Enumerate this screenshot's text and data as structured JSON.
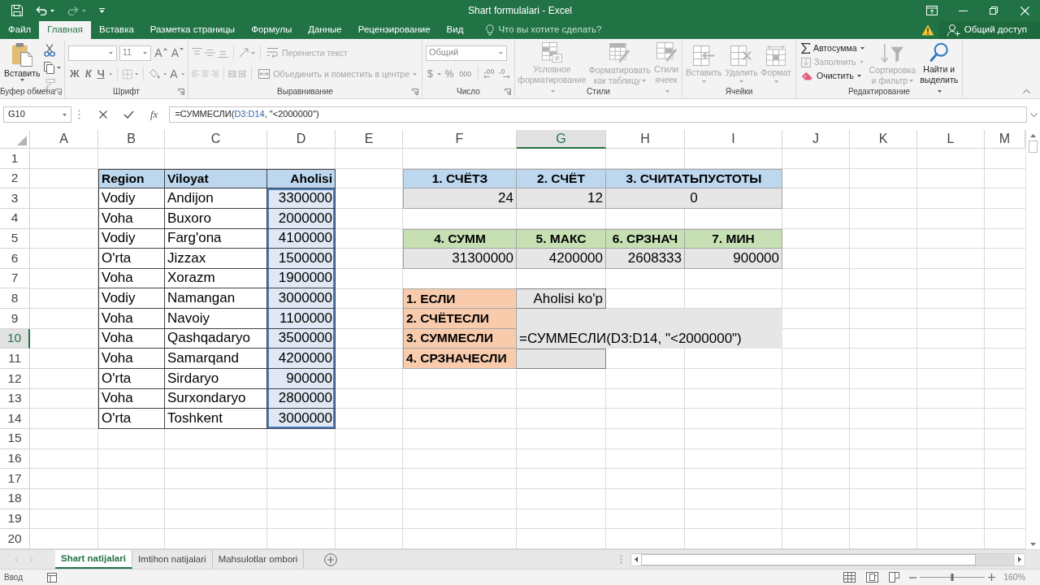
{
  "window": {
    "title": "Shart formulalari - Excel"
  },
  "quick_access": [
    {
      "kind": "save",
      "disabled": false
    },
    {
      "kind": "undo",
      "disabled": false
    },
    {
      "kind": "redo",
      "disabled": true
    },
    {
      "kind": "customize",
      "disabled": false
    }
  ],
  "ribbon_tabs": [
    {
      "label": "Файл",
      "selected": false
    },
    {
      "label": "Главная",
      "selected": true
    },
    {
      "label": "Вставка",
      "selected": false
    },
    {
      "label": "Разметка страницы",
      "selected": false
    },
    {
      "label": "Формулы",
      "selected": false
    },
    {
      "label": "Данные",
      "selected": false
    },
    {
      "label": "Рецензирование",
      "selected": false
    },
    {
      "label": "Вид",
      "selected": false
    }
  ],
  "tell_me": {
    "placeholder": "Что вы хотите сделать?"
  },
  "share_button": {
    "label": "Общий доступ"
  },
  "ribbon": {
    "groups": [
      {
        "kind": "clipboard",
        "label": "Буфер обмена",
        "paste": {
          "label": "Вставить",
          "disabled": false
        },
        "tools": [
          {
            "kind": "cut",
            "disabled": false
          },
          {
            "kind": "copy",
            "disabled": false
          },
          {
            "kind": "format_painter",
            "disabled": true
          }
        ]
      },
      {
        "kind": "font",
        "label": "Шрифт",
        "font_size": "11",
        "size_buttons": [
          {
            "kind": "grow",
            "label": "A"
          },
          {
            "kind": "shrink",
            "label": "A"
          }
        ],
        "style_buttons": [
          {
            "kind": "bold",
            "label": "Ж"
          },
          {
            "kind": "italic",
            "label": "К"
          },
          {
            "kind": "underline",
            "label": "Ч"
          }
        ],
        "color_button": {
          "label": "A"
        }
      },
      {
        "kind": "alignment",
        "label": "Выравнивание",
        "wrap": {
          "label": "Перенести текст",
          "disabled": true
        },
        "merge": {
          "label": "Объединить и поместить в центре",
          "disabled": true
        }
      },
      {
        "kind": "number",
        "label": "Число",
        "format": "Общий",
        "buttons": [
          {
            "kind": "currency",
            "label": "$"
          },
          {
            "kind": "percent",
            "label": "%"
          },
          {
            "kind": "thousands",
            "label": "000"
          }
        ]
      },
      {
        "kind": "styles",
        "label": "Стили",
        "buttons": [
          {
            "kind": "conditional",
            "label": "Условное\nформатирование",
            "disabled": true
          },
          {
            "kind": "table",
            "label": "Форматировать\nкак таблицу",
            "disabled": true
          },
          {
            "kind": "cell_styles",
            "label": "Стили\nячеек",
            "disabled": true
          }
        ]
      },
      {
        "kind": "cells",
        "label": "Ячейки",
        "buttons": [
          {
            "kind": "insert",
            "label": "Вставить",
            "disabled": true
          },
          {
            "kind": "delete",
            "label": "Удалить",
            "disabled": true
          },
          {
            "kind": "format",
            "label": "Формат",
            "disabled": true
          }
        ]
      },
      {
        "kind": "editing",
        "label": "Редактирование",
        "small": [
          {
            "kind": "autosum",
            "label": "Автосумма",
            "disabled": false
          },
          {
            "kind": "fill",
            "label": "Заполнить",
            "disabled": true
          },
          {
            "kind": "clear",
            "label": "Очистить",
            "disabled": false
          }
        ],
        "large": [
          {
            "kind": "sort",
            "label": "Сортировка\nи фильтр",
            "disabled": true
          },
          {
            "kind": "find",
            "label": "Найти и\nвыделить",
            "disabled": false
          }
        ]
      }
    ]
  },
  "formula_bar": {
    "name_box": "G10",
    "function_button": "fx",
    "formula": [
      {
        "text": "=СУММЕСЛИ(",
        "kind": "plain"
      },
      {
        "text": "D3:D14",
        "kind": "reference"
      },
      {
        "text": ", \"<2000000\")",
        "kind": "plain"
      }
    ]
  },
  "sheet": {
    "columns": [
      {
        "label": "A",
        "selected": false
      },
      {
        "label": "B",
        "selected": false
      },
      {
        "label": "C",
        "selected": false
      },
      {
        "label": "D",
        "selected": false
      },
      {
        "label": "E",
        "selected": false
      },
      {
        "label": "F",
        "selected": false
      },
      {
        "label": "G",
        "selected": true
      },
      {
        "label": "H",
        "selected": false
      },
      {
        "label": "I",
        "selected": false
      },
      {
        "label": "J",
        "selected": false
      },
      {
        "label": "K",
        "selected": false
      },
      {
        "label": "L",
        "selected": false
      },
      {
        "label": "M",
        "selected": false
      }
    ],
    "rows": [
      {
        "label": "1",
        "selected": false
      },
      {
        "label": "2",
        "selected": false,
        "B": {
          "text": "Region",
          "kind": "label",
          "color": "#bdd7ee",
          "border": {
            "color": "#404040"
          },
          "highlighted": false
        },
        "C": {
          "text": "Viloyat",
          "kind": "label",
          "color": "#bdd7ee",
          "border": {
            "color": "#404040"
          },
          "highlighted": false
        },
        "D": {
          "text": "Aholisi",
          "kind": "label_right",
          "color": "#bdd7ee",
          "border": {
            "color": "#404040"
          },
          "highlighted": false
        },
        "F": {
          "text": "1. СЧЁТЗ",
          "kind": "heading",
          "color": "#bdd7ee",
          "border": {
            "color": "#a6a6a6"
          },
          "highlighted": false
        },
        "G": {
          "text": "2. СЧЁТ",
          "kind": "heading",
          "color": "#bdd7ee",
          "border": {
            "color": "#a6a6a6"
          },
          "highlighted": false
        },
        "H": {
          "text": "3. СЧИТАТЬПУСТОТЫ",
          "kind": "heading",
          "color": "#bdd7ee",
          "border": {
            "color": "#a6a6a6"
          },
          "highlighted": false
        },
        "I": {
          "merged": true
        }
      },
      {
        "label": "3",
        "selected": false,
        "B": {
          "text": "Vodiy",
          "kind": "text",
          "border": {
            "color": "#404040"
          },
          "highlighted": false
        },
        "C": {
          "text": "Andijon",
          "kind": "text",
          "border": {
            "color": "#404040"
          },
          "highlighted": false
        },
        "D": {
          "text": "3300000",
          "kind": "number",
          "border": {
            "color": "#404040"
          },
          "highlighted": true
        },
        "F": {
          "text": "24",
          "kind": "number",
          "color": "#e7e6e6",
          "border": {
            "color": "#a6a6a6"
          },
          "highlighted": false
        },
        "G": {
          "text": "12",
          "kind": "number",
          "color": "#e7e6e6",
          "border": {
            "color": "#a6a6a6"
          },
          "highlighted": false
        },
        "H": {
          "text": "0",
          "kind": "centered",
          "color": "#e7e6e6",
          "border": {
            "color": "#a6a6a6"
          },
          "highlighted": false
        },
        "I": {
          "merged": true
        }
      },
      {
        "label": "4",
        "selected": false,
        "B": {
          "text": "Voha",
          "kind": "text",
          "border": {
            "color": "#404040"
          },
          "highlighted": false
        },
        "C": {
          "text": "Buxoro",
          "kind": "text",
          "border": {
            "color": "#404040"
          },
          "highlighted": false
        },
        "D": {
          "text": "2000000",
          "kind": "number",
          "border": {
            "color": "#404040"
          },
          "highlighted": true
        }
      },
      {
        "label": "5",
        "selected": false,
        "B": {
          "text": "Vodiy",
          "kind": "text",
          "border": {
            "color": "#404040"
          },
          "highlighted": false
        },
        "C": {
          "text": "Farg'ona",
          "kind": "text",
          "border": {
            "color": "#404040"
          },
          "highlighted": false
        },
        "D": {
          "text": "4100000",
          "kind": "number",
          "border": {
            "color": "#404040"
          },
          "highlighted": true
        },
        "F": {
          "text": "4. СУММ",
          "kind": "heading",
          "color": "#c6e0b4",
          "border": {
            "color": "#a6a6a6"
          },
          "highlighted": false
        },
        "G": {
          "text": "5. МАКС",
          "kind": "heading",
          "color": "#c6e0b4",
          "border": {
            "color": "#a6a6a6"
          },
          "highlighted": false
        },
        "H": {
          "text": "6. СРЗНАЧ",
          "kind": "heading",
          "color": "#c6e0b4",
          "border": {
            "color": "#a6a6a6"
          },
          "highlighted": false
        },
        "I": {
          "text": "7. МИН",
          "kind": "heading",
          "color": "#c6e0b4",
          "border": {
            "color": "#a6a6a6"
          },
          "highlighted": false
        }
      },
      {
        "label": "6",
        "selected": false,
        "B": {
          "text": "O'rta",
          "kind": "text",
          "border": {
            "color": "#404040"
          },
          "highlighted": false
        },
        "C": {
          "text": "Jizzax",
          "kind": "text",
          "border": {
            "color": "#404040"
          },
          "highlighted": false
        },
        "D": {
          "text": "1500000",
          "kind": "number",
          "border": {
            "color": "#404040"
          },
          "highlighted": true
        },
        "F": {
          "text": "31300000",
          "kind": "number",
          "color": "#e7e6e6",
          "border": {
            "color": "#a6a6a6"
          },
          "highlighted": false
        },
        "G": {
          "text": "4200000",
          "kind": "number",
          "color": "#e7e6e6",
          "border": {
            "color": "#a6a6a6"
          },
          "highlighted": false
        },
        "H": {
          "text": "2608333",
          "kind": "number",
          "color": "#e7e6e6",
          "border": {
            "color": "#a6a6a6"
          },
          "highlighted": false
        },
        "I": {
          "text": "900000",
          "kind": "number",
          "color": "#e7e6e6",
          "border": {
            "color": "#a6a6a6"
          },
          "highlighted": false
        }
      },
      {
        "label": "7",
        "selected": false,
        "B": {
          "text": "Voha",
          "kind": "text",
          "border": {
            "color": "#404040"
          },
          "highlighted": false
        },
        "C": {
          "text": "Xorazm",
          "kind": "text",
          "border": {
            "color": "#404040"
          },
          "highlighted": false
        },
        "D": {
          "text": "1900000",
          "kind": "number",
          "border": {
            "color": "#404040"
          },
          "highlighted": true
        }
      },
      {
        "label": "8",
        "selected": false,
        "B": {
          "text": "Vodiy",
          "kind": "text",
          "border": {
            "color": "#404040"
          },
          "highlighted": false
        },
        "C": {
          "text": "Namangan",
          "kind": "text",
          "border": {
            "color": "#404040"
          },
          "highlighted": false
        },
        "D": {
          "text": "3000000",
          "kind": "number",
          "border": {
            "color": "#404040"
          },
          "highlighted": true
        },
        "F": {
          "text": "1. ЕСЛИ",
          "kind": "label",
          "color": "#f8cbad",
          "border": {
            "color": "#a6a6a6"
          },
          "highlighted": false
        },
        "G": {
          "text": "Aholisi ko'p",
          "kind": "right_text",
          "color": "#e7e6e6",
          "border": {
            "color": "#808080"
          },
          "highlighted": false
        }
      },
      {
        "label": "9",
        "selected": false,
        "B": {
          "text": "Voha",
          "kind": "text",
          "border": {
            "color": "#404040"
          },
          "highlighted": false
        },
        "C": {
          "text": "Navoiy",
          "kind": "text",
          "border": {
            "color": "#404040"
          },
          "highlighted": false
        },
        "D": {
          "text": "1100000",
          "kind": "number",
          "border": {
            "color": "#404040"
          },
          "highlighted": true
        },
        "F": {
          "text": "2. СЧЁТЕСЛИ",
          "kind": "label",
          "color": "#f8cbad",
          "border": {
            "color": "#a6a6a6"
          },
          "highlighted": false
        },
        "G": {
          "color": "#e7e6e6"
        },
        "H": {
          "color": "#e7e6e6"
        },
        "I": {
          "color": "#e7e6e6"
        }
      },
      {
        "label": "10",
        "selected": true,
        "B": {
          "text": "Voha",
          "kind": "text",
          "border": {
            "color": "#404040"
          },
          "highlighted": false
        },
        "C": {
          "text": "Qashqadaryo",
          "kind": "text",
          "border": {
            "color": "#404040"
          },
          "highlighted": false
        },
        "D": {
          "text": "3500000",
          "kind": "number",
          "border": {
            "color": "#404040"
          },
          "highlighted": true
        },
        "F": {
          "text": "3. СУММЕСЛИ",
          "kind": "label",
          "color": "#f8cbad",
          "border": {
            "color": "#a6a6a6"
          },
          "highlighted": false
        },
        "G": {
          "text": "=СУММЕСЛИ(D3:D14, \"<2000000\")",
          "kind": "text",
          "color": "#e7e6e6",
          "highlighted": false
        },
        "H": {
          "merged": true
        },
        "I": {
          "merged": true
        }
      },
      {
        "label": "11",
        "selected": false,
        "B": {
          "text": "Voha",
          "kind": "text",
          "border": {
            "color": "#404040"
          },
          "highlighted": false
        },
        "C": {
          "text": "Samarqand",
          "kind": "text",
          "border": {
            "color": "#404040"
          },
          "highlighted": false
        },
        "D": {
          "text": "4200000",
          "kind": "number",
          "border": {
            "color": "#404040"
          },
          "highlighted": true
        },
        "F": {
          "text": "4. СРЗНАЧЕСЛИ",
          "kind": "label",
          "color": "#f8cbad",
          "border": {
            "color": "#a6a6a6"
          },
          "highlighted": false
        },
        "G": {
          "color": "#e7e6e6",
          "border": {
            "color": "#808080"
          }
        }
      },
      {
        "label": "12",
        "selected": false,
        "B": {
          "text": "O'rta",
          "kind": "text",
          "border": {
            "color": "#404040"
          },
          "highlighted": false
        },
        "C": {
          "text": "Sirdaryo",
          "kind": "text",
          "border": {
            "color": "#404040"
          },
          "highlighted": false
        },
        "D": {
          "text": "900000",
          "kind": "number",
          "border": {
            "color": "#404040"
          },
          "highlighted": true
        }
      },
      {
        "label": "13",
        "selected": false,
        "B": {
          "text": "Voha",
          "kind": "text",
          "border": {
            "color": "#404040"
          },
          "highlighted": false
        },
        "C": {
          "text": "Surxondaryo",
          "kind": "text",
          "border": {
            "color": "#404040"
          },
          "highlighted": false
        },
        "D": {
          "text": "2800000",
          "kind": "number",
          "border": {
            "color": "#404040"
          },
          "highlighted": true
        }
      },
      {
        "label": "14",
        "selected": false,
        "B": {
          "text": "O'rta",
          "kind": "text",
          "border": {
            "color": "#404040"
          },
          "highlighted": false
        },
        "C": {
          "text": "Toshkent",
          "kind": "text",
          "border": {
            "color": "#404040"
          },
          "highlighted": false
        },
        "D": {
          "text": "3000000",
          "kind": "number",
          "border": {
            "color": "#404040"
          },
          "highlighted": true
        }
      },
      {
        "label": "15",
        "selected": false
      },
      {
        "label": "16",
        "selected": false
      },
      {
        "label": "17",
        "selected": false
      },
      {
        "label": "18",
        "selected": false
      },
      {
        "label": "19",
        "selected": false
      },
      {
        "label": "20",
        "selected": false
      }
    ]
  },
  "sheet_tabs": [
    {
      "label": "Shart natijalari",
      "selected": true
    },
    {
      "label": "Imtihon natijalari",
      "selected": false
    },
    {
      "label": "Mahsulotlar ombori",
      "selected": false
    }
  ],
  "status_bar": {
    "mode": "Ввод",
    "view_buttons": [
      {
        "kind": "normal"
      },
      {
        "kind": "page_layout"
      },
      {
        "kind": "page_break"
      }
    ],
    "zoom": {
      "level": 0.5,
      "label": "160%"
    }
  }
}
